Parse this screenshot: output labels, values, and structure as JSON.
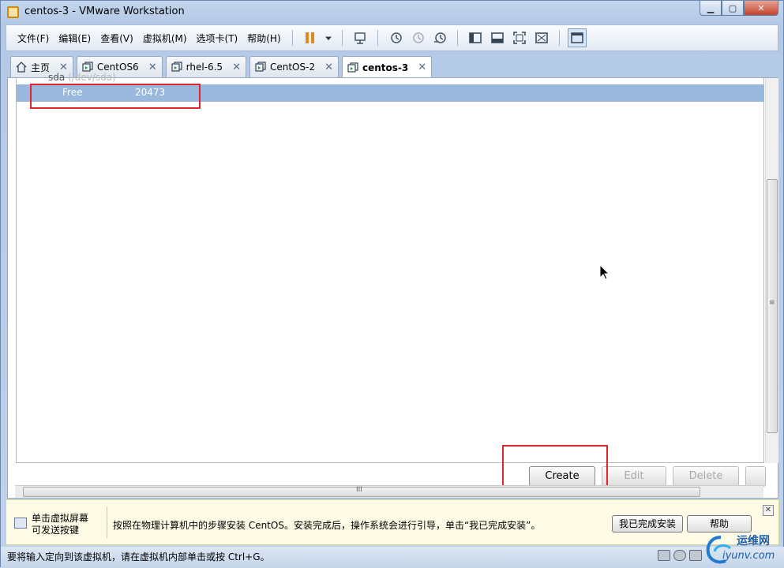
{
  "window": {
    "title": "centos-3 - VMware Workstation",
    "min": "▁",
    "max": "▢",
    "close": "✕"
  },
  "menus": [
    "文件(F)",
    "编辑(E)",
    "查看(V)",
    "虚拟机(M)",
    "选项卡(T)",
    "帮助(H)"
  ],
  "tabs": [
    {
      "label": "主页"
    },
    {
      "label": "CentOS6"
    },
    {
      "label": "rhel-6.5"
    },
    {
      "label": "CentOS-2"
    },
    {
      "label": "centos-3"
    }
  ],
  "tab_close": "✕",
  "partition": {
    "device": "sda",
    "device_path": "(/dev/sda)",
    "free_label": "Free",
    "free_size": "20473"
  },
  "buttons": {
    "create": "Create",
    "edit": "Edit",
    "delete": "Delete"
  },
  "hint": {
    "line1": "单击虚拟屏幕",
    "line2": "可发送按键",
    "message": "按照在物理计算机中的步骤安装 CentOS。安装完成后，操作系统会进行引导，单击“我已完成安装”。",
    "done_button": "我已完成安装",
    "help_button": "帮助",
    "close": "✕"
  },
  "status": {
    "text": "要将输入定向到该虚拟机，请在虚拟机内部单击或按 Ctrl+G。"
  },
  "watermark": {
    "name": "运维网",
    "url": "iyunv.com"
  },
  "scroll_grip": "≡",
  "hscroll_grip": "III",
  "colors": {
    "selection": "#9ab8de",
    "highlight_box": "#e0262b"
  }
}
